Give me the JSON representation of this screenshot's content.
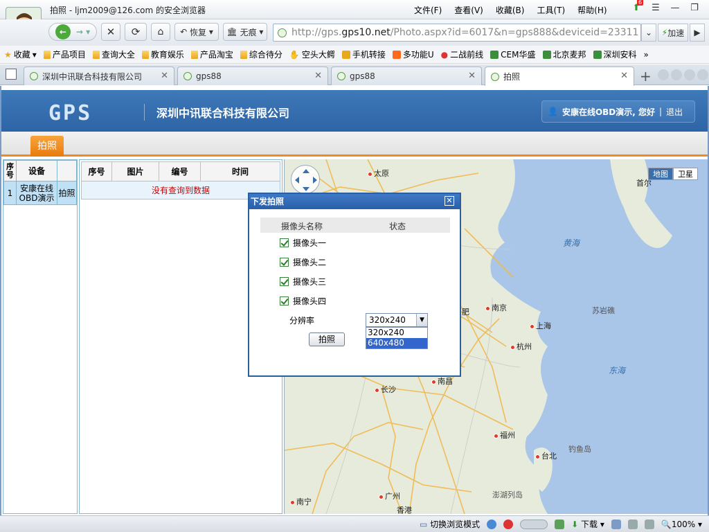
{
  "window": {
    "title": "拍照 - ljm2009@126.com 的安全浏览器",
    "menu": [
      "文件(F)",
      "查看(V)",
      "收藏(B)",
      "工具(T)",
      "帮助(H)"
    ],
    "badge_count": "6"
  },
  "nav": {
    "restore_label": "恢复",
    "incognito_label": "无痕",
    "url_prefix": "http://gps.",
    "url_host": "gps10.net",
    "url_path": "/Photo.aspx?id=6017&n=gps888&deviceid=23311",
    "speedup_label": "加速"
  },
  "bookmarks": [
    "收藏",
    "产品项目",
    "查询大全",
    "教育娱乐",
    "产品淘宝",
    "综合待分",
    "空头大鳄",
    "手机转接",
    "多功能U",
    "二战前线",
    "CEM华盛",
    "北京麦邦",
    "深圳安科"
  ],
  "tabs": [
    {
      "label": "深圳中讯联合科技有限公司"
    },
    {
      "label": "gps88"
    },
    {
      "label": "gps88"
    },
    {
      "label": "拍照"
    }
  ],
  "header": {
    "logo": "GPS",
    "company": "深圳中讯联合科技有限公司",
    "greeting": "安康在线OBD演示, 您好",
    "logout": "退出",
    "active_tab": "拍照"
  },
  "device_table": {
    "headers": [
      "序号",
      "设备",
      ""
    ],
    "rows": [
      {
        "index": "1",
        "device": "安康在线OBD演示",
        "action": "拍照"
      }
    ]
  },
  "photo_table": {
    "headers": [
      "序号",
      "图片",
      "编号",
      "时间"
    ],
    "empty_message": "没有查询到数据"
  },
  "map": {
    "types": [
      "地图",
      "卫星"
    ],
    "seas": [
      "黄海",
      "东海"
    ],
    "cities": [
      "太原",
      "首尔",
      "南京",
      "上海",
      "杭州",
      "肥",
      "南昌",
      "长沙",
      "福州",
      "台北",
      "广州",
      "香港",
      "南宁",
      "苏岩礁",
      "钓鱼岛",
      "澎湖列岛"
    ]
  },
  "dialog": {
    "title": "下发拍照",
    "col_name": "摄像头名称",
    "col_status": "状态",
    "cameras": [
      "摄像头一",
      "摄像头二",
      "摄像头三",
      "摄像头四"
    ],
    "resolution_label": "分辨率",
    "resolution_selected": "320x240",
    "resolution_options": [
      "320x240",
      "640x480"
    ],
    "button": "拍照"
  },
  "status": {
    "mode": "切换浏览模式",
    "download": "下载",
    "zoom": "100%"
  }
}
